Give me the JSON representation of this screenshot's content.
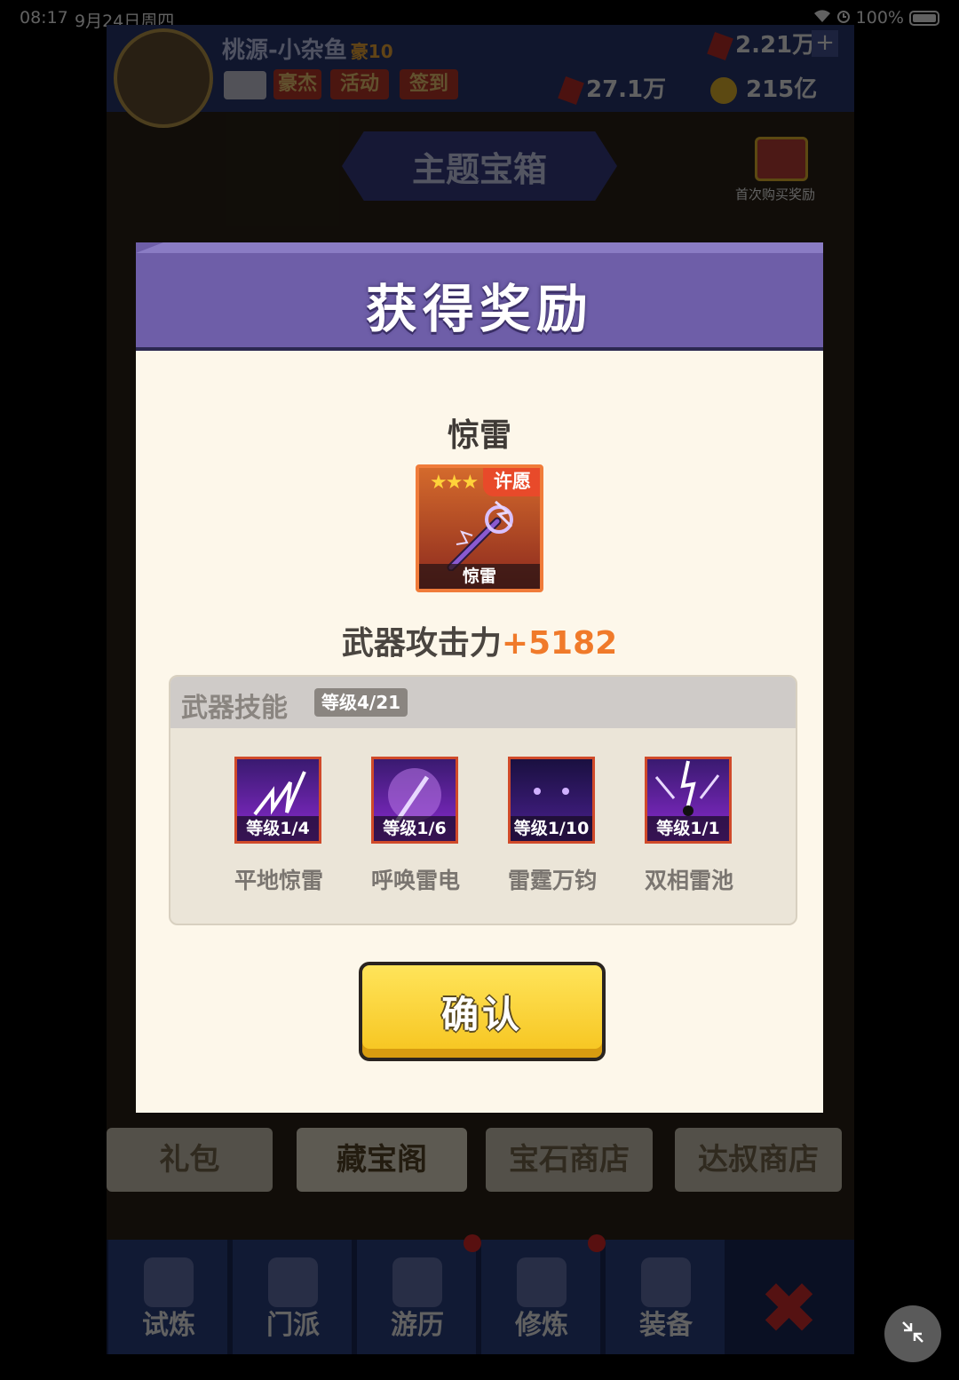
{
  "status_bar": {
    "time": "08:17",
    "date": "9月24日周四",
    "battery": "100%"
  },
  "game_bg": {
    "player_name": "桃源-小杂鱼",
    "vip": "豪10",
    "buttons": [
      "豪杰",
      "活动",
      "签到"
    ],
    "gems": "2.21万",
    "tickets": "27.1万",
    "coins": "215亿",
    "banner": "主题宝箱",
    "first_purchase": "首次购买奖励",
    "shop_tabs": [
      "礼包",
      "藏宝阁",
      "宝石商店",
      "达叔商店"
    ],
    "nav": [
      "试炼",
      "门派",
      "游历",
      "修炼",
      "装备"
    ]
  },
  "dialog": {
    "title": "获得奖励",
    "item_name": "惊雷",
    "card_label": "惊雷",
    "card_badge": "许愿",
    "stars": "★★★",
    "attack_label": "武器攻击力",
    "attack_value": "+5182",
    "skills_title": "武器技能",
    "skills_level": "等级4/21",
    "skills": [
      {
        "level": "等级1/4",
        "name": "平地惊雷"
      },
      {
        "level": "等级1/6",
        "name": "呼唤雷电"
      },
      {
        "level": "等级1/10",
        "name": "雷霆万钧"
      },
      {
        "level": "等级1/1",
        "name": "双相雷池"
      }
    ],
    "confirm": "确认"
  }
}
